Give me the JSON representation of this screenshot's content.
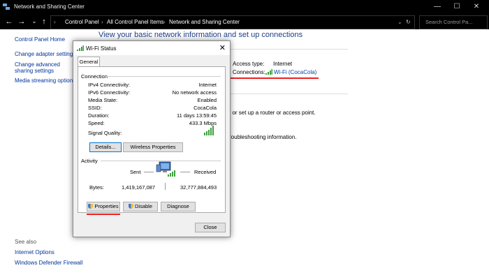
{
  "window": {
    "title": "Network and Sharing Center"
  },
  "titlebar": {
    "minimize": "—",
    "maximize": "☐",
    "close": "✕"
  },
  "nav": {
    "back": "←",
    "forward": "→",
    "up": "↑",
    "breadcrumb": [
      "Control Panel",
      "All Control Panel Items",
      "Network and Sharing Center"
    ],
    "search_placeholder": "Search Control Pa..."
  },
  "sidebar": {
    "home": "Control Panel Home",
    "items": [
      "Change adapter settings",
      "Change advanced sharing settings",
      "Media streaming options"
    ],
    "see_also": "See also",
    "see_also_items": [
      "Internet Options",
      "Windows Defender Firewall"
    ]
  },
  "main": {
    "heading": "View your basic network information and set up connections",
    "access_type_label": "Access type:",
    "access_type_value": "Internet",
    "connections_label": "Connections:",
    "connections_value": "Wi-Fi (CocaCola)",
    "setup_text": "; or set up a router or access point.",
    "troubleshoot_text": "roubleshooting information."
  },
  "dialog": {
    "title": "Wi-Fi Status",
    "close": "✕",
    "tab": "General",
    "connection_section": "Connection",
    "rows": [
      {
        "label": "IPv4 Connectivity:",
        "value": "Internet"
      },
      {
        "label": "IPv6 Connectivity:",
        "value": "No network access"
      },
      {
        "label": "Media State:",
        "value": "Enabled"
      },
      {
        "label": "SSID:",
        "value": "CocaCola"
      },
      {
        "label": "Duration:",
        "value": "11 days 13:59:45"
      },
      {
        "label": "Speed:",
        "value": "433.3 Mbps"
      }
    ],
    "signal_label": "Signal Quality:",
    "details_button": "Details...",
    "wireless_button": "Wireless Properties",
    "activity_section": "Activity",
    "sent_label": "Sent",
    "received_label": "Received",
    "bytes_label": "Bytes:",
    "bytes_sent": "1,419,167,087",
    "bytes_received": "32,777,884,493",
    "properties_button": "Properties",
    "disable_button": "Disable",
    "diagnose_button": "Diagnose",
    "close_button": "Close"
  },
  "colors": {
    "accent": "#0078d7",
    "highlight": "#e22222",
    "link": "#003399"
  }
}
